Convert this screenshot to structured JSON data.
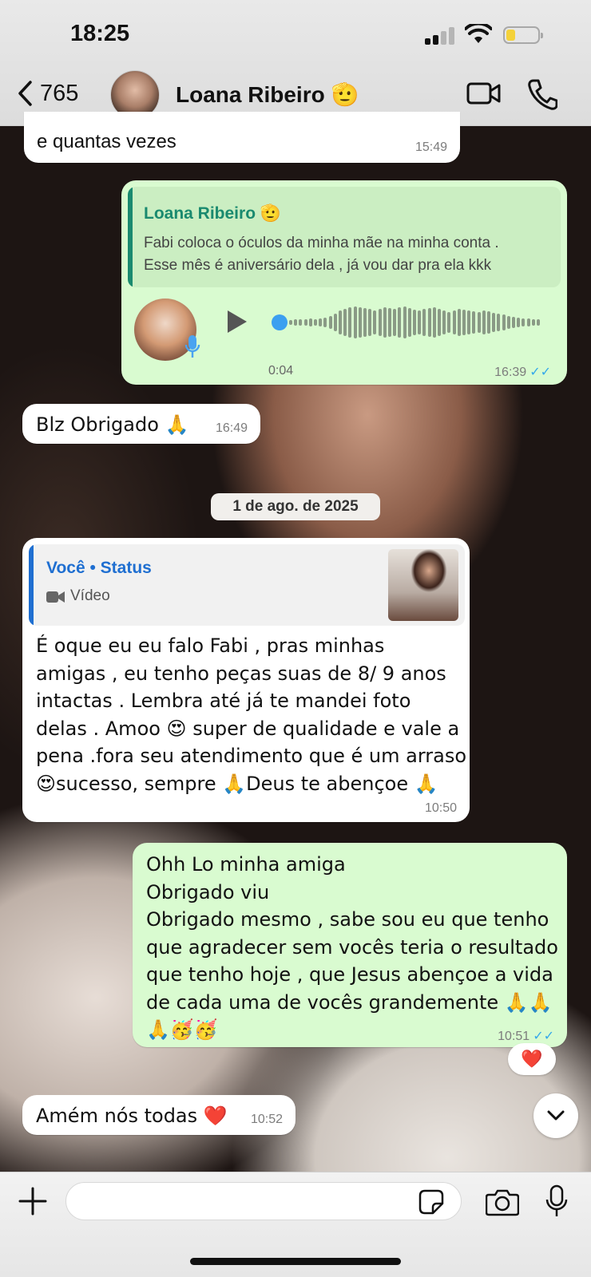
{
  "status_bar": {
    "time": "18:25"
  },
  "header": {
    "back_count": "765",
    "contact_name": "Loana Ribeiro 🫡"
  },
  "messages": {
    "m1": {
      "text": "e quantas vezes",
      "time": "15:49"
    },
    "m2": {
      "quote_author": "Loana Ribeiro 🫡",
      "quote_line1": "Fabi coloca o óculos da minha mãe na minha conta .",
      "quote_line2": "Esse mês é aniversário dela , já vou dar pra ela kkk",
      "duration": "0:04",
      "time": "16:39",
      "ticks": "✓✓"
    },
    "m3": {
      "text": "Blz Obrigado 🙏",
      "time": "16:49"
    },
    "date_separator": "1 de ago. de 2025",
    "m4": {
      "quote_author": "Você • Status",
      "quote_type": "Vídeo",
      "lines": [
        "É oque  eu eu falo Fabi , pras minhas",
        "amigas , eu tenho peças suas de 8/ 9 anos",
        "intactas . Lembra até já te mandei foto",
        "delas . Amoo 😍 super de qualidade e vale a",
        "pena .fora seu atendimento que é um arraso",
        "😍sucesso, sempre 🙏Deus te abençoe 🙏"
      ],
      "time": "10:50"
    },
    "m5": {
      "lines": [
        "Ohh Lo minha amiga",
        "Obrigado viu",
        "Obrigado mesmo , sabe sou eu que tenho",
        "que agradecer sem vocês teria o resultado",
        "que tenho hoje , que Jesus abençoe a vida",
        "de cada uma de vocês grandemente 🙏🙏",
        "🙏🥳🥳"
      ],
      "time": "10:51",
      "ticks": "✓✓",
      "reaction": "❤️"
    },
    "m6": {
      "text": "Amém nós todas ❤️",
      "time": "10:52"
    }
  },
  "composer": {
    "placeholder": "",
    "value": ""
  },
  "colors": {
    "incoming_bubble": "#ffffff",
    "outgoing_bubble": "#d9fbd0",
    "quote_green": "#1a8a6f",
    "quote_blue": "#1f6fd1",
    "read_ticks": "#34a8ea"
  },
  "icons": [
    "chevron-left-icon",
    "video-camera-icon",
    "phone-icon",
    "play-icon",
    "microphone-icon",
    "video-icon",
    "chevron-down-icon",
    "plus-icon",
    "sticker-icon",
    "camera-icon"
  ]
}
